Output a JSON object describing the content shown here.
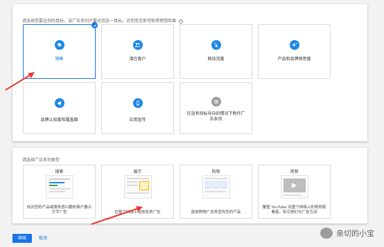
{
  "goals": {
    "prompt": "请选择您要达到的目标，该广告系列只要达到这一目标，对您而言即可取得理想效果",
    "cards": [
      {
        "label": "销售",
        "icon": "tag-icon",
        "selected": true
      },
      {
        "label": "潜在客户",
        "icon": "people-icon",
        "selected": false
      },
      {
        "label": "网站流量",
        "icon": "cursor-click-icon",
        "selected": false
      },
      {
        "label": "产品和品牌钟意度",
        "icon": "sparkle-icon",
        "selected": false
      },
      {
        "label": "品牌认知度和覆盖面",
        "icon": "megaphone-icon",
        "selected": false
      },
      {
        "label": "应用宣传",
        "icon": "phone-icon",
        "selected": false
      },
      {
        "label": "在没有目标导向的情况下制作广告系列",
        "icon": "gear-icon",
        "selected": false
      }
    ]
  },
  "types": {
    "prompt": "请选择广告系列类型",
    "cards": [
      {
        "title": "搜索",
        "desc": "向对您的产品或服务感兴趣的客户展示文字广告"
      },
      {
        "title": "展示",
        "desc": "在整个网络上投放各类广告"
      },
      {
        "title": "购物",
        "desc": "投放购物广告来宣传您的产品"
      },
      {
        "title": "视频",
        "desc": "覆盖 YouTube 及整个网络上的视频观看者，吸引他们与广告互动"
      }
    ]
  },
  "actions": {
    "continue": "继续",
    "cancel": "取消"
  },
  "watermark": "亲切的小宝",
  "colors": {
    "accent": "#1a73e8",
    "arrow": "#e53935"
  }
}
